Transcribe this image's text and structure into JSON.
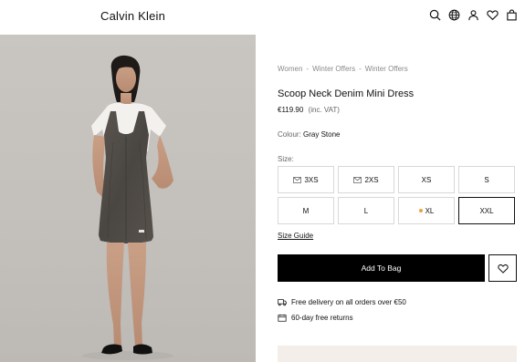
{
  "header": {
    "logo": "Calvin Klein",
    "icons": [
      "search-icon",
      "globe-icon",
      "account-icon",
      "heart-icon",
      "bag-icon"
    ]
  },
  "breadcrumb": [
    "Women",
    "Winter Offers",
    "Winter Offers"
  ],
  "breadcrumb_separator": "-",
  "product": {
    "title": "Scoop Neck Denim Mini Dress",
    "price": "€119.90",
    "vat_note": "(inc. VAT)",
    "colour_label": "Colour:",
    "colour_value": "Gray Stone"
  },
  "sizes": {
    "label": "Size:",
    "options": [
      {
        "label": "3XS",
        "marker": "envelope"
      },
      {
        "label": "2XS",
        "marker": "envelope"
      },
      {
        "label": "XS",
        "marker": ""
      },
      {
        "label": "S",
        "marker": ""
      },
      {
        "label": "M",
        "marker": ""
      },
      {
        "label": "L",
        "marker": ""
      },
      {
        "label": "XL",
        "marker": "dot"
      },
      {
        "label": "XXL",
        "marker": "",
        "selected": true
      }
    ],
    "size_guide": "Size Guide"
  },
  "actions": {
    "add_to_bag": "Add To Bag"
  },
  "features": {
    "delivery": "Free delivery on all orders over €50",
    "returns": "60-day free returns"
  },
  "colors": {
    "accent_dot": "#e8a43c",
    "button_bg": "#000000",
    "bottom_panel": "#f4eeea"
  }
}
